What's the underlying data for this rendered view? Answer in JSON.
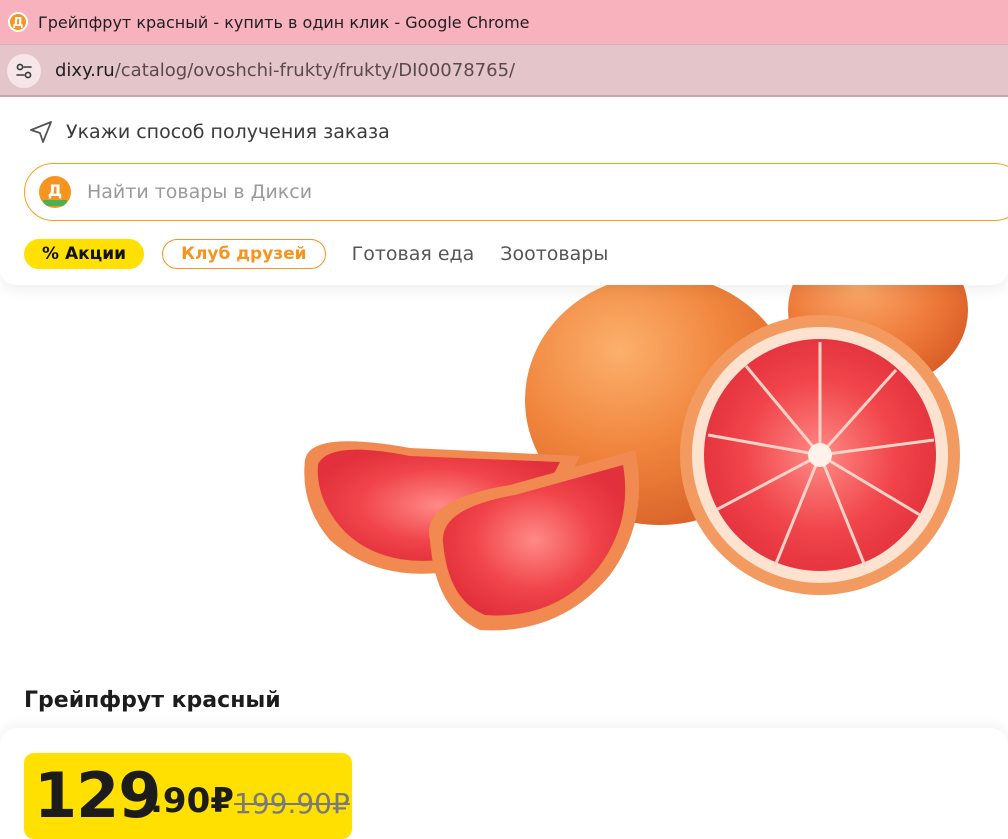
{
  "browser": {
    "window_title": "Грейпфрут красный - купить в один клик - Google Chrome",
    "url_host": "dixy.ru",
    "url_path": "/catalog/ovoshchi-frukty/frukty/DI00078765/",
    "favicon_letter": "Д"
  },
  "header": {
    "delivery_prompt": "Укажи способ получения заказа",
    "search_placeholder": "Найти товары в Дикси",
    "logo_letter": "Д",
    "nav": {
      "promo_label": "% Акции",
      "club_label": "Клуб друзей",
      "links": [
        "Готовая еда",
        "Зоотовары"
      ]
    }
  },
  "product": {
    "name": "Грейпфрут красный",
    "price_rub": "129",
    "price_kop": ".90₽",
    "old_price": "199.90₽"
  },
  "colors": {
    "accent_yellow": "#ffe000",
    "accent_orange": "#f7941d",
    "titlebar_bg": "#f7b2bd"
  }
}
